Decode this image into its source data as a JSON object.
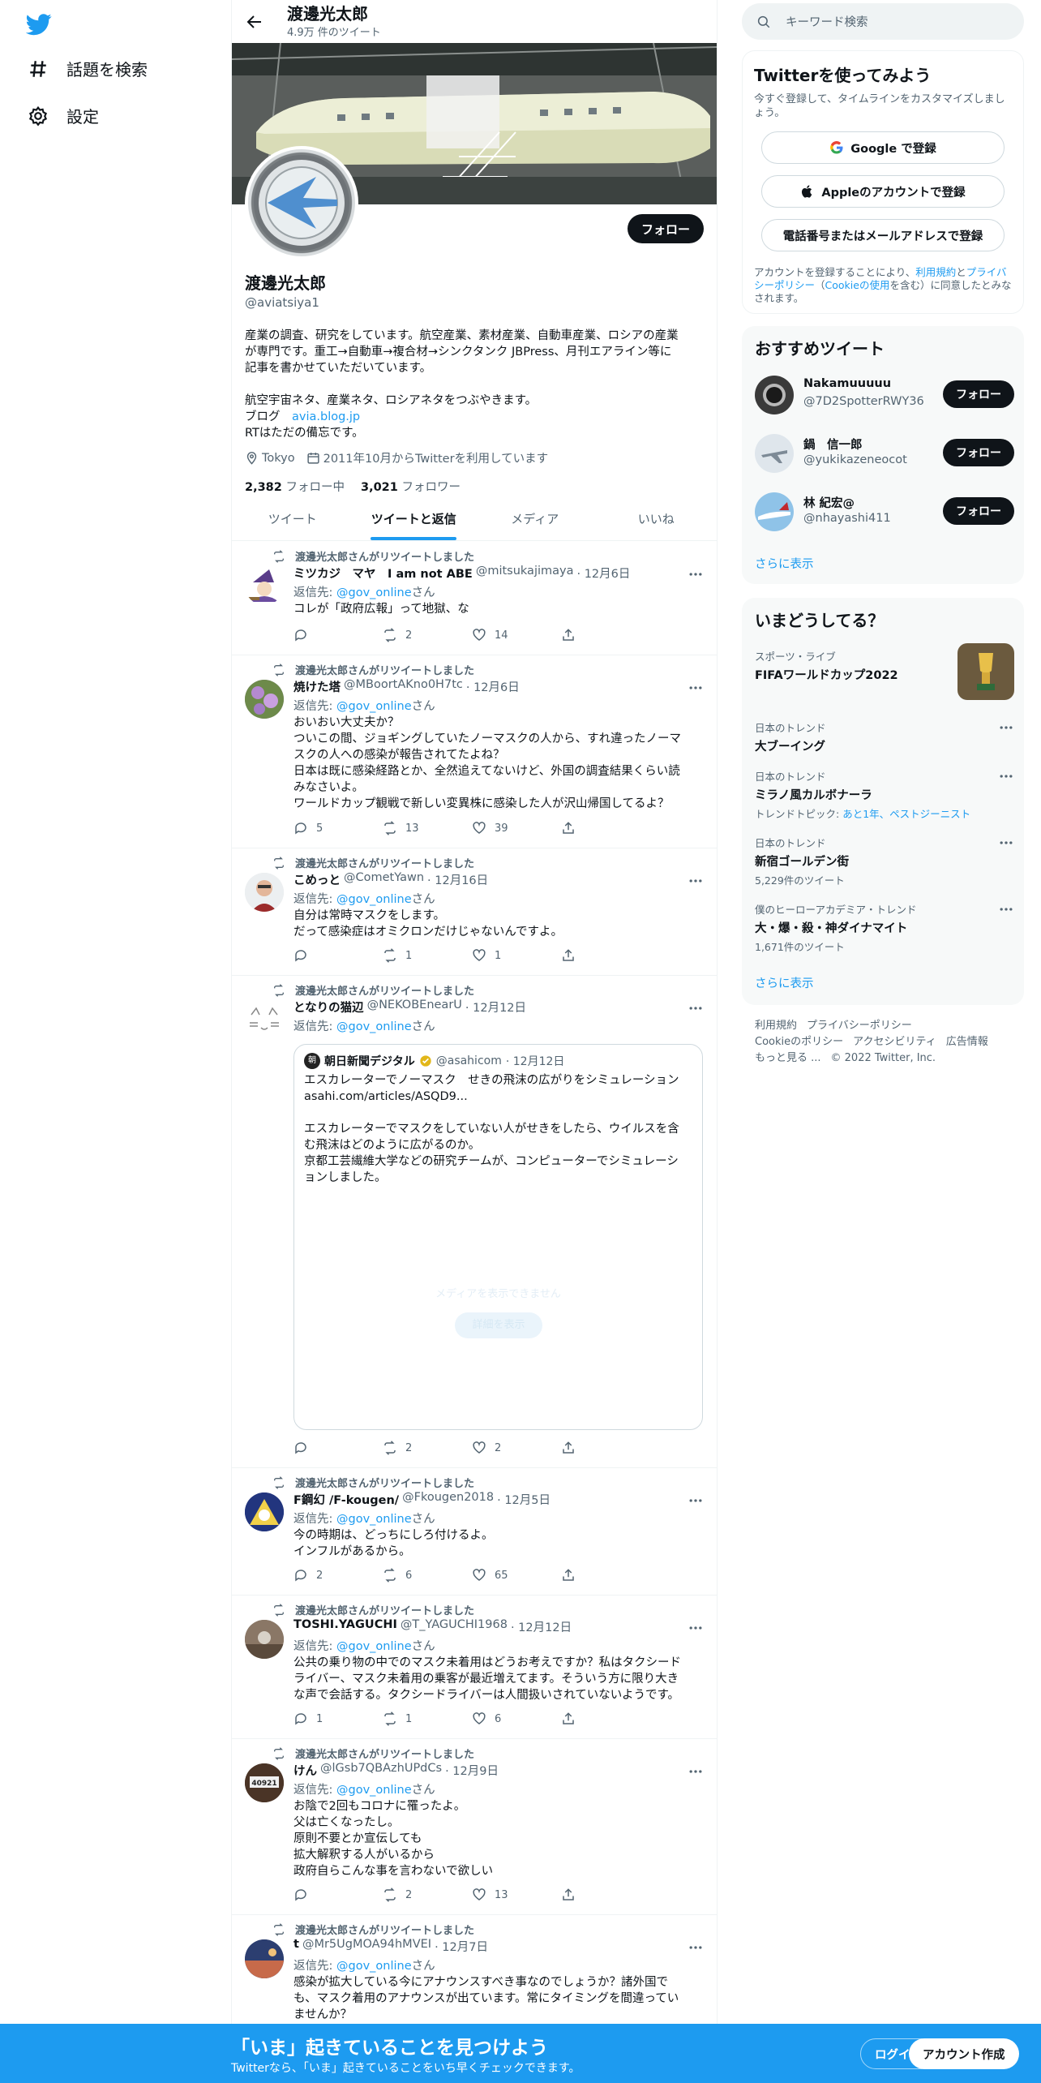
{
  "nav": {
    "explore_label": "話題を検索",
    "settings_label": "設定"
  },
  "profile": {
    "header_title": "渡邊光太郎",
    "header_tweets": "4.9万 件のツイート",
    "name": "渡邊光太郎",
    "handle": "@aviatsiya1",
    "follow_label": "フォロー",
    "bio": [
      "産業の調査、研究をしています。航空産業、素材産業、自動車産業、ロシアの産業",
      "が専門です。重工→自動車→複合材→シンクタンク JBPress、月刊エアライン等に",
      "記事を書かせていただいています。",
      "",
      "航空宇宙ネタ、産業ネタ、ロシアネタをつぶやきます。"
    ],
    "blog_label": "ブログ",
    "blog_link": "avia.blog.jp",
    "bio_last": "RTはただの備忘です。",
    "location": "Tokyo",
    "joined": "2011年10月からTwitterを利用しています",
    "following_count": "2,382",
    "following_label": "フォロー中",
    "followers_count": "3,021",
    "followers_label": "フォロワー"
  },
  "tabs": [
    "ツイート",
    "ツイートと返信",
    "メディア",
    "いいね"
  ],
  "retweet_label": "渡邊光太郎さんがリツイートしました",
  "reply_prefix": "返信先:",
  "reply_to": "@gov_online",
  "reply_suffix": "さん",
  "tweets": [
    {
      "name": "ミツカジ　マヤ　I am not ABE",
      "handle": "@mitsukajimaya",
      "date": "· 12月6日",
      "text": [
        "コレが「政府広報」って地獄、な"
      ],
      "replies": "",
      "retweets": "2",
      "likes": "14"
    },
    {
      "name": "焼けた塔",
      "handle": "@MBoortAKno0H7tc",
      "date": "· 12月6日",
      "text": [
        "おいおい大丈夫か？",
        "ついこの間、ジョギングしていたノーマスクの人から、すれ違ったノーマ",
        "スクの人への感染が報告されてたよね？",
        "日本は既に感染経路とか、全然追えてないけど、外国の調査結果くらい読",
        "みなさいよ。",
        "ワールドカップ観戦で新しい変異株に感染した人が沢山帰国してるよ？"
      ],
      "replies": "5",
      "retweets": "13",
      "likes": "39"
    },
    {
      "name": "こめっと",
      "handle": "@CometYawn",
      "date": "· 12月16日",
      "text": [
        "自分は常時マスクをします。",
        "だって感染症はオミクロンだけじゃないんですよ。"
      ],
      "replies": "",
      "retweets": "1",
      "likes": "1"
    },
    {
      "name": "となりの猫辺",
      "handle": "@NEKOBEnearU",
      "date": "· 12月12日",
      "text": [],
      "replies": "",
      "retweets": "2",
      "likes": "2",
      "quote": {
        "avatar_text": "朝",
        "name": "朝日新聞デジタル",
        "handle": "@asahicom",
        "date": "· 12月12日",
        "text": [
          "エスカレーターでノーマスク　せきの飛沫の広がりをシミュレーション",
          "asahi.com/articles/ASQD9...",
          "",
          "エスカレーターでマスクをしていない人がせきをしたら、ウイルスを含",
          "む飛沫はどのように広がるのか。",
          "京都工芸繊維大学などの研究チームが、コンピューターでシミュレーシ",
          "ョンしました。"
        ],
        "ghost_text": "メディアを表示できません",
        "ghost_button": "詳細を表示"
      }
    },
    {
      "name": "F鋼幻 /F-kougen/",
      "handle": "@Fkougen2018",
      "date": "· 12月5日",
      "text": [
        "今の時期は、どっちにしろ付けるよ。",
        "インフルがあるから。"
      ],
      "replies": "2",
      "retweets": "6",
      "likes": "65"
    },
    {
      "name": "TOSHI.YAGUCHI",
      "handle": "@T_YAGUCHI1968",
      "date": "· 12月12日",
      "text": [
        "公共の乗り物の中でのマスク未着用はどうお考えですか？私はタクシード",
        "ライバー、マスク未着用の乗客が最近増えてます。そういう方に限り大き",
        "な声で会話する。タクシードライバーは人間扱いされていないようです。"
      ],
      "replies": "1",
      "retweets": "1",
      "likes": "6"
    },
    {
      "name": "けん",
      "handle": "@lGsb7QBAzhUPdCs",
      "date": "· 12月9日",
      "text": [
        "お陰で2回もコロナに罹ったよ。",
        "父は亡くなったし。",
        "原則不要とか宣伝しても",
        "拡大解釈する人がいるから",
        "政府自らこんな事を言わないで欲しい"
      ],
      "replies": "",
      "retweets": "2",
      "likes": "13"
    },
    {
      "name": "t",
      "handle": "@Mr5UgMOA94hMVEI",
      "date": "· 12月7日",
      "text": [
        "感染が拡大している今にアナウンスすべき事なのでしょうか？諸外国で",
        "も、マスク着用のアナウンスが出ています。常にタイミングを間違ってい",
        "ませんか？"
      ],
      "replies": "",
      "retweets": "",
      "likes": ""
    }
  ],
  "search": {
    "placeholder": "キーワード検索"
  },
  "signup": {
    "title": "Twitterを使ってみよう",
    "lead": "今すぐ登録して、タイムラインをカスタマイズしましょう。",
    "google": "Google で登録",
    "apple": "Appleのアカウントで登録",
    "phone": "電話番号またはメールアドレスで登録",
    "terms_1": "アカウントを登録することにより、",
    "terms_link1": "利用規約",
    "terms_2": "と",
    "terms_link2": "プライバシーポリシー",
    "terms_3": "（",
    "terms_link3": "Cookieの使用",
    "terms_4": "を含む）に同意したとみなされます。"
  },
  "recommend": {
    "title": "おすすめツイート",
    "follow_label": "フォロー",
    "show_more": "さらに表示",
    "users": [
      {
        "name": "Nakamuuuuu",
        "handle": "@7D2SpotterRWY36"
      },
      {
        "name": "鍋　信一郎",
        "handle": "@yukikazeneocot"
      },
      {
        "name": "林 紀宏@",
        "handle": "@nhayashi411"
      }
    ]
  },
  "trends": {
    "title": "いまどうしてる？",
    "show_more": "さらに表示",
    "items": [
      {
        "category": "スポーツ・ライブ",
        "name": "FIFAワールドカップ2022",
        "meta": ""
      },
      {
        "category": "日本のトレンド",
        "name": "大ブーイング",
        "meta": ""
      },
      {
        "category": "日本のトレンド",
        "name": "ミラノ風カルボナーラ",
        "meta_prefix": "トレンドトピック:",
        "meta": "あと1年、ペストジーニスト"
      },
      {
        "category": "日本のトレンド",
        "name": "新宿ゴールデン街",
        "meta": "5,229件のツイート"
      },
      {
        "category": "僕のヒーローアカデミア・トレンド",
        "name": "大・爆・殺・神ダイナマイト",
        "meta": "1,671件のツイート"
      }
    ]
  },
  "footer": {
    "links": [
      "利用規約",
      "プライバシーポリシー",
      "Cookieのポリシー",
      "アクセシビリティ",
      "広告情報",
      "もっと見る ..."
    ],
    "copyright": "© 2022 Twitter, Inc."
  },
  "bottombar": {
    "title": "「いま」起きていることを見つけよう",
    "subtitle": "Twitterなら、「いま」起きていることをいち早くチェックできます。",
    "login": "ログイン",
    "signup": "アカウント作成"
  }
}
